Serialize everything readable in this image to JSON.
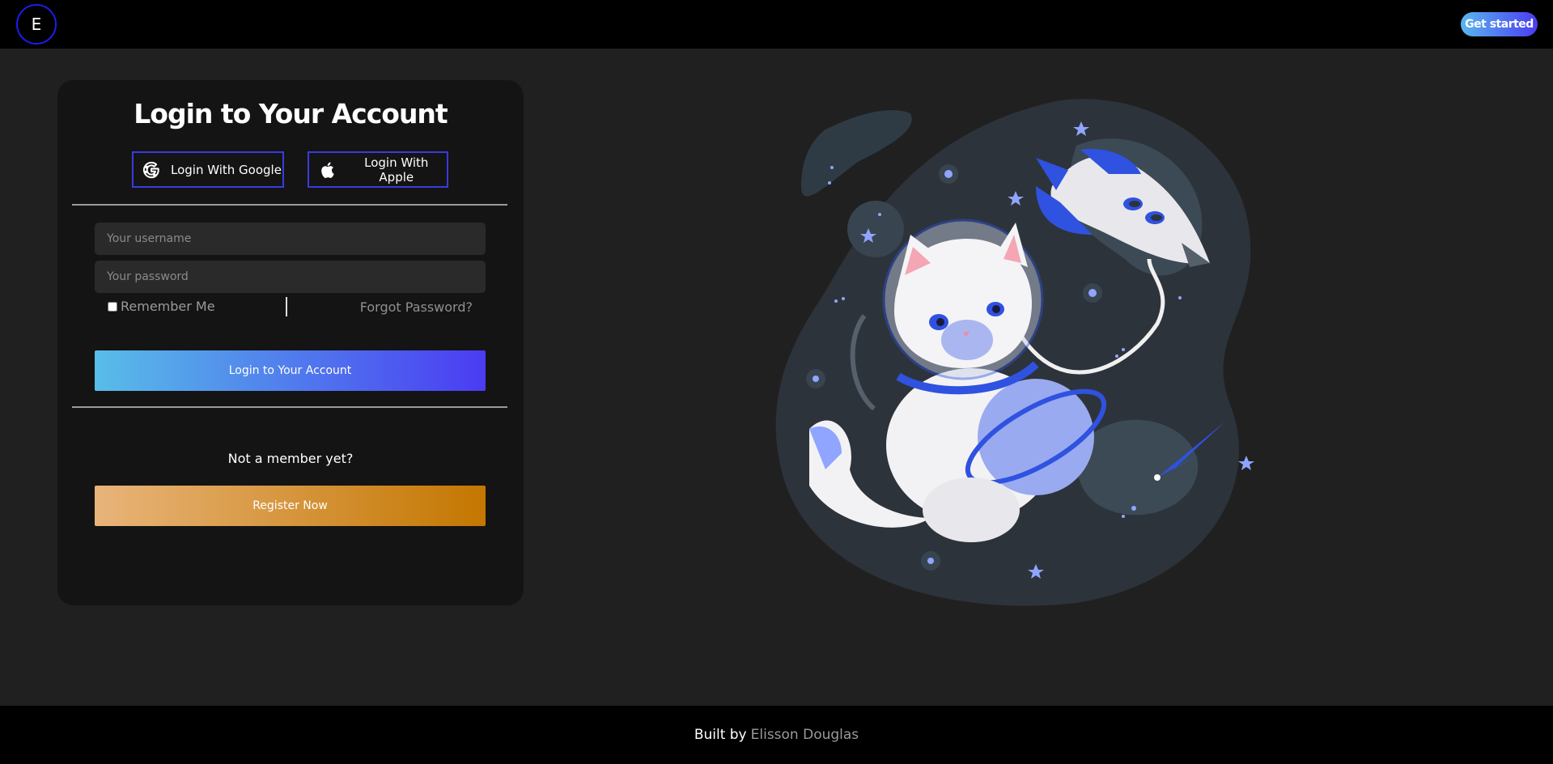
{
  "header": {
    "logo_letter": "E",
    "get_started_label": "Get started"
  },
  "login_card": {
    "title": "Login to Your Account",
    "google_label": "Login With Google",
    "apple_label": "Login With Apple",
    "username_placeholder": "Your username",
    "password_placeholder": "Your password",
    "remember_label": "Remember Me",
    "forgot_label": "Forgot Password?",
    "login_button_label": "Login to Your Account",
    "not_member_text": "Not a member yet?",
    "register_button_label": "Register Now"
  },
  "footer": {
    "built_by": "Built by",
    "author": "Elisson Douglas"
  },
  "colors": {
    "accent_blue": "#4a3cf0",
    "accent_gold": "#c47700",
    "background": "#202020"
  },
  "icons": [
    "google-icon",
    "apple-icon"
  ]
}
